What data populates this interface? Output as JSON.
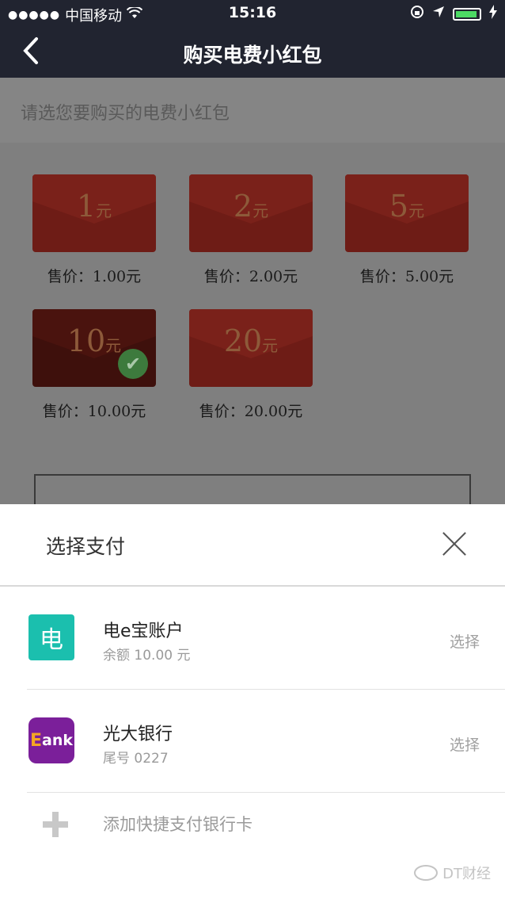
{
  "status_bar": {
    "signal": "●●●●●",
    "carrier": "中国移动",
    "wifi_icon": "wifi",
    "time": "15:16",
    "battery": "charging"
  },
  "nav": {
    "back_glyph": "‹",
    "title": "购买电费小红包"
  },
  "page": {
    "prompt": "请选您要购买的电费小红包",
    "packets": [
      {
        "amount": "1",
        "unit": "元",
        "price": "售价：1.00元",
        "selected": false
      },
      {
        "amount": "2",
        "unit": "元",
        "price": "售价：2.00元",
        "selected": false
      },
      {
        "amount": "5",
        "unit": "元",
        "price": "售价：5.00元",
        "selected": false
      },
      {
        "amount": "10",
        "unit": "元",
        "price": "售价：10.00元",
        "selected": true
      },
      {
        "amount": "20",
        "unit": "元",
        "price": "售价：20.00元",
        "selected": false
      }
    ]
  },
  "sheet": {
    "title": "选择支付",
    "methods": [
      {
        "icon": "电",
        "name": "电e宝账户",
        "detail": "余额 10.00 元",
        "action": "选择"
      },
      {
        "icon": "Bank",
        "name": "光大银行",
        "detail": "尾号 0227",
        "action": "选择"
      }
    ],
    "add_card": "添加快捷支付银行卡"
  },
  "watermark": "DT财经",
  "colors": {
    "nav_bg": "#212430",
    "packet_red": "#6e1c16",
    "dian_green": "#1bbfae",
    "bank_purple": "#7b1f9a"
  }
}
